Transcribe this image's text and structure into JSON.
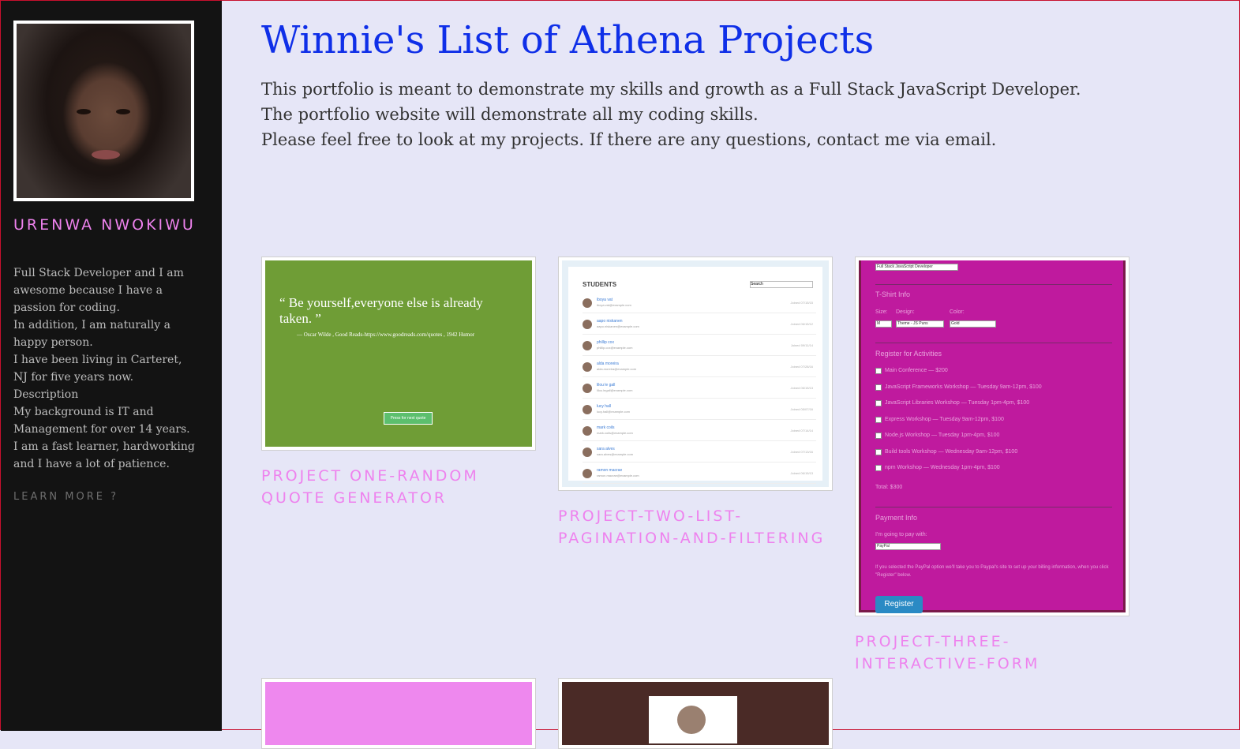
{
  "sidebar": {
    "name": "URENWA NWOKIWU",
    "bio": [
      "Full Stack Developer and I am awesome because I have a passion for coding.",
      "In addition, I am naturally a happy person.",
      "I have been living in Carteret, NJ for five years now.",
      "Description",
      "My background is IT and Management for over 14 years.",
      "I am a fast learner, hardworking and I have a lot of patience."
    ],
    "learn_more": "LEARN MORE ?"
  },
  "main": {
    "title": "Winnie's List of Athena Projects",
    "intro": [
      "This portfolio is meant to demonstrate my skills and growth as a Full Stack JavaScript Developer.",
      "The portfolio website will demonstrate all my coding skills.",
      "Please feel free to look at my projects. If there are any questions, contact me via email."
    ],
    "projects": [
      {
        "title": "PROJECT ONE-RANDOM QUOTE GENERATOR",
        "thumb_quote": "“ Be yourself,everyone else is already taken. ”",
        "thumb_source": "— Oscar Wilde , Good Reads-https://www.goodreads.com/quotes , 1942 Humor",
        "thumb_button": "Press for next quote"
      },
      {
        "title": "PROJECT-TWO-LIST-PAGINATION-AND-FILTERING",
        "thumb_header": "STUDENTS",
        "thumb_search": "Search",
        "thumb_students": [
          {
            "name": "iboya vat",
            "email": "iboya.vat@example.com",
            "joined": "Joined 07/15/15"
          },
          {
            "name": "aapo niskanen",
            "email": "aapo.niskanen@example.com",
            "joined": "Joined 06/15/12"
          },
          {
            "name": "phillip cox",
            "email": "phillip.cox@example.com",
            "joined": "Joined 09/11/14"
          },
          {
            "name": "alda moreira",
            "email": "alda.moreira@example.com",
            "joined": "Joined 07/28/16"
          },
          {
            "name": "lilou le gall",
            "email": "lilou.legall@example.com",
            "joined": "Joined 06/15/13"
          },
          {
            "name": "lucy hall",
            "email": "lucy.hall@example.com",
            "joined": "Joined 05/07/16"
          },
          {
            "name": "mark coils",
            "email": "mark.coils@example.com",
            "joined": "Joined 07/14/14"
          },
          {
            "name": "sara alves",
            "email": "sara.alves@example.com",
            "joined": "Joined 07/13/16"
          },
          {
            "name": "ramon macrae",
            "email": "ramon.macrae@example.com",
            "joined": "Joined 06/15/13"
          }
        ]
      },
      {
        "title": "PROJECT-THREE-INTERACTIVE-FORM",
        "thumb_job": "Full Stack JavaScript Developer",
        "thumb_tshirt": "T-Shirt Info",
        "thumb_size_label": "Size:",
        "thumb_design_label": "Design:",
        "thumb_color_label": "Color:",
        "thumb_size": "M",
        "thumb_design": "Theme - JS Puns",
        "thumb_color": "Gold",
        "thumb_activities_heading": "Register for Activities",
        "thumb_activities": [
          "Main Conference — $200",
          "JavaScript Frameworks Workshop — Tuesday 9am-12pm, $100",
          "JavaScript Libraries Workshop — Tuesday 1pm-4pm, $100",
          "Express Workshop — Tuesday 9am-12pm, $100",
          "Node.js Workshop — Tuesday 1pm-4pm, $100",
          "Build tools Workshop — Wednesday 9am-12pm, $100",
          "npm Workshop — Wednesday 1pm-4pm, $100"
        ],
        "thumb_total": "Total: $300",
        "thumb_payment_heading": "Payment Info",
        "thumb_pay_label": "I'm going to pay with:",
        "thumb_pay_method": "PayPal",
        "thumb_pay_note": "If you selected the PayPal option we'll take you to Paypal's site to set up your billing information, when you click \"Register\" below.",
        "thumb_register": "Register"
      },
      {
        "title": ""
      },
      {
        "title": ""
      }
    ]
  }
}
